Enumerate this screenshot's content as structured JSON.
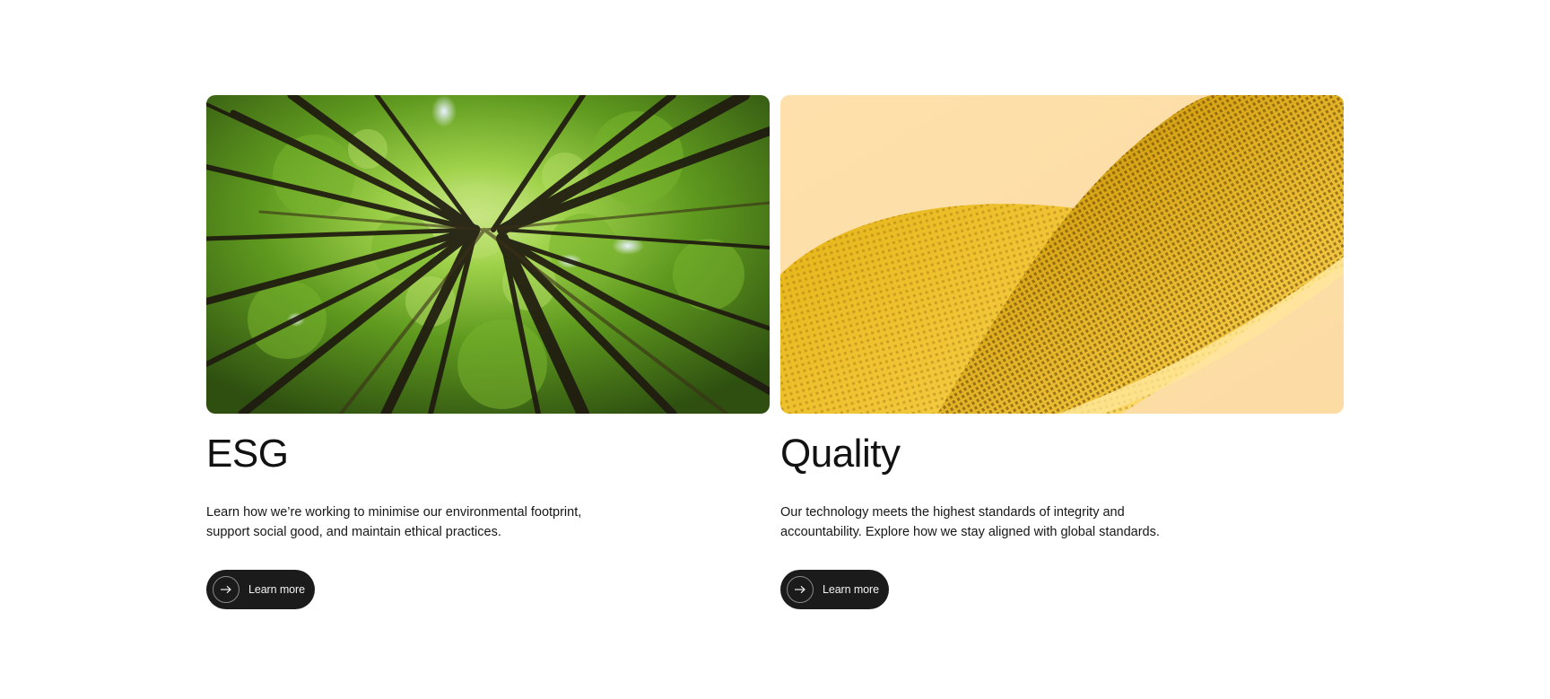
{
  "cards": [
    {
      "title": "ESG",
      "description": "Learn how we’re working to minimise our environmental footprint, support social good, and maintain ethical practices.",
      "cta_label": "Learn more",
      "cta_icon": "arrow-right-icon",
      "image": "forest-canopy-image"
    },
    {
      "title": "Quality",
      "description": "Our technology meets the highest standards of integrity and accountability. Explore how we stay aligned with global standards.",
      "cta_label": "Learn more",
      "cta_icon": "arrow-right-icon",
      "image": "golden-mesh-image"
    }
  ],
  "colors": {
    "background": "#ffffff",
    "text": "#121212",
    "button": "#1b1b1b",
    "button_text": "#f2f2f2",
    "forest_green": "#5f9a1f",
    "quality_peach": "#fde0ab",
    "quality_gold": "#e3b317"
  }
}
